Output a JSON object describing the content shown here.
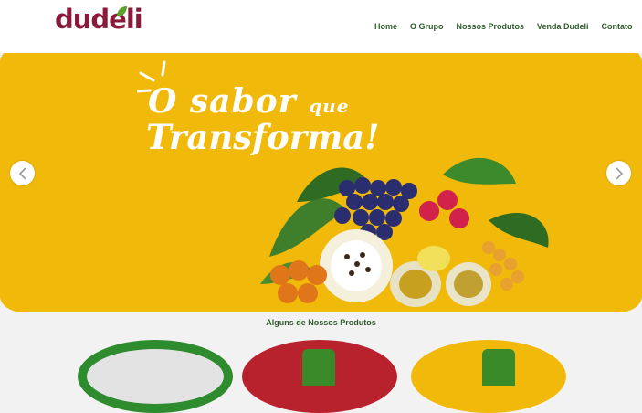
{
  "brand": {
    "logo_text": "dudeli"
  },
  "nav": {
    "items": [
      "Home",
      "O Grupo",
      "Nossos Produtos",
      "Venda Dudeli",
      "Contato"
    ]
  },
  "hero": {
    "slogan_line1_a": "O sabor",
    "slogan_line1_b": "que",
    "slogan_line2": "Transforma!",
    "prev_icon": "chevron-left-icon",
    "next_icon": "chevron-right-icon"
  },
  "products": {
    "title": "Alguns de Nossos Produtos"
  },
  "colors": {
    "hero_background": "#f1b90a",
    "nav_text": "#2f5a2c",
    "logo": "#8a1a3a",
    "leaf": "#5aa02a"
  }
}
